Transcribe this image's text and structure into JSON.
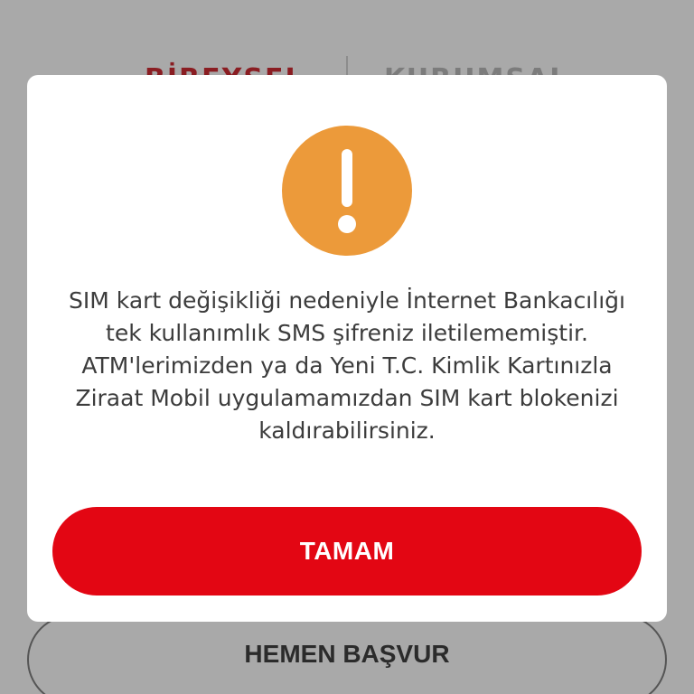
{
  "background": {
    "tabs": {
      "left_label": "BİREYSEL",
      "right_label": "KURUMSAL"
    },
    "apply_button_label": "HEMEN BAŞVUR"
  },
  "modal": {
    "icon": "exclamation-warning-icon",
    "message": "SIM kart değişikliği nedeniyle İnternet Bankacılığı tek kullanımlık SMS şifreniz iletilememiştir. ATM'lerimizden ya da Yeni T.C. Kimlik Kartınızla Ziraat Mobil uygulamamızdan SIM kart blokenizi kaldırabilirsiniz.",
    "ok_label": "TAMAM"
  },
  "colors": {
    "overlay": "#a9a9a9",
    "primary_red": "#e30613",
    "warning_orange": "#ec9a3a"
  }
}
